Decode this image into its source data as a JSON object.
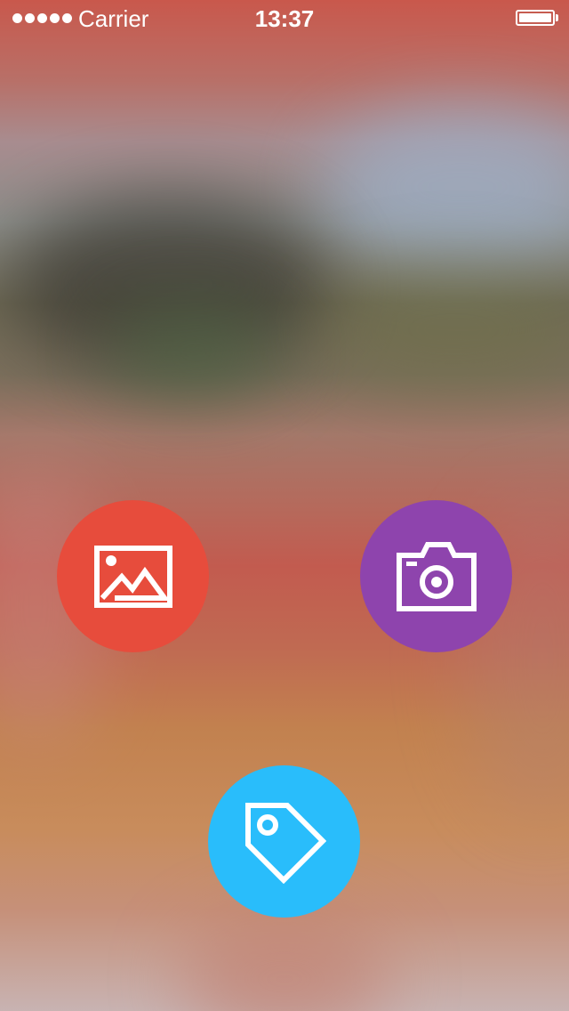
{
  "status_bar": {
    "carrier": "Carrier",
    "time": "13:37",
    "signal_bars": 5,
    "battery_level": 1.0
  },
  "actions": [
    {
      "name": "gallery",
      "icon": "image-icon",
      "color": "#e74c3c"
    },
    {
      "name": "camera",
      "icon": "camera-icon",
      "color": "#8e44ad"
    },
    {
      "name": "tag",
      "icon": "tag-icon",
      "color": "#29bdfb"
    }
  ]
}
